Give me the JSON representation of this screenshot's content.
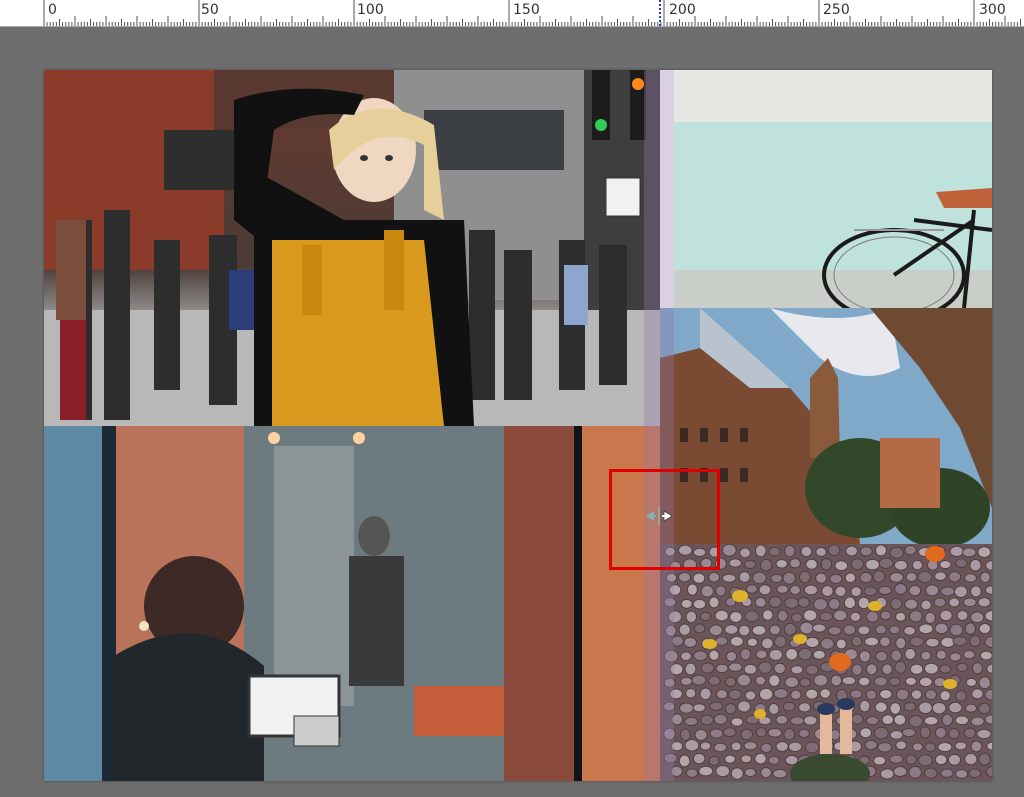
{
  "ruler": {
    "labels": [
      "0",
      "50",
      "100",
      "150",
      "200",
      "250",
      "300"
    ]
  },
  "canvas": {
    "photos": [
      {
        "name": "photo-woman-yellow-overalls",
        "subject": "street portrait"
      },
      {
        "name": "photo-bicycle-wall",
        "subject": "bicycle against mint wall"
      },
      {
        "name": "photo-buildings-sky",
        "subject": "buildings looking up"
      },
      {
        "name": "photo-cafe-window",
        "subject": "person at laptop in cafe window"
      },
      {
        "name": "photo-cobblestone-leaves",
        "subject": "cobblestones with autumn leaves"
      }
    ]
  },
  "colors": {
    "workspace": "#6e6e6e",
    "selection": "#e00000",
    "guide": "#1f3fbf"
  }
}
